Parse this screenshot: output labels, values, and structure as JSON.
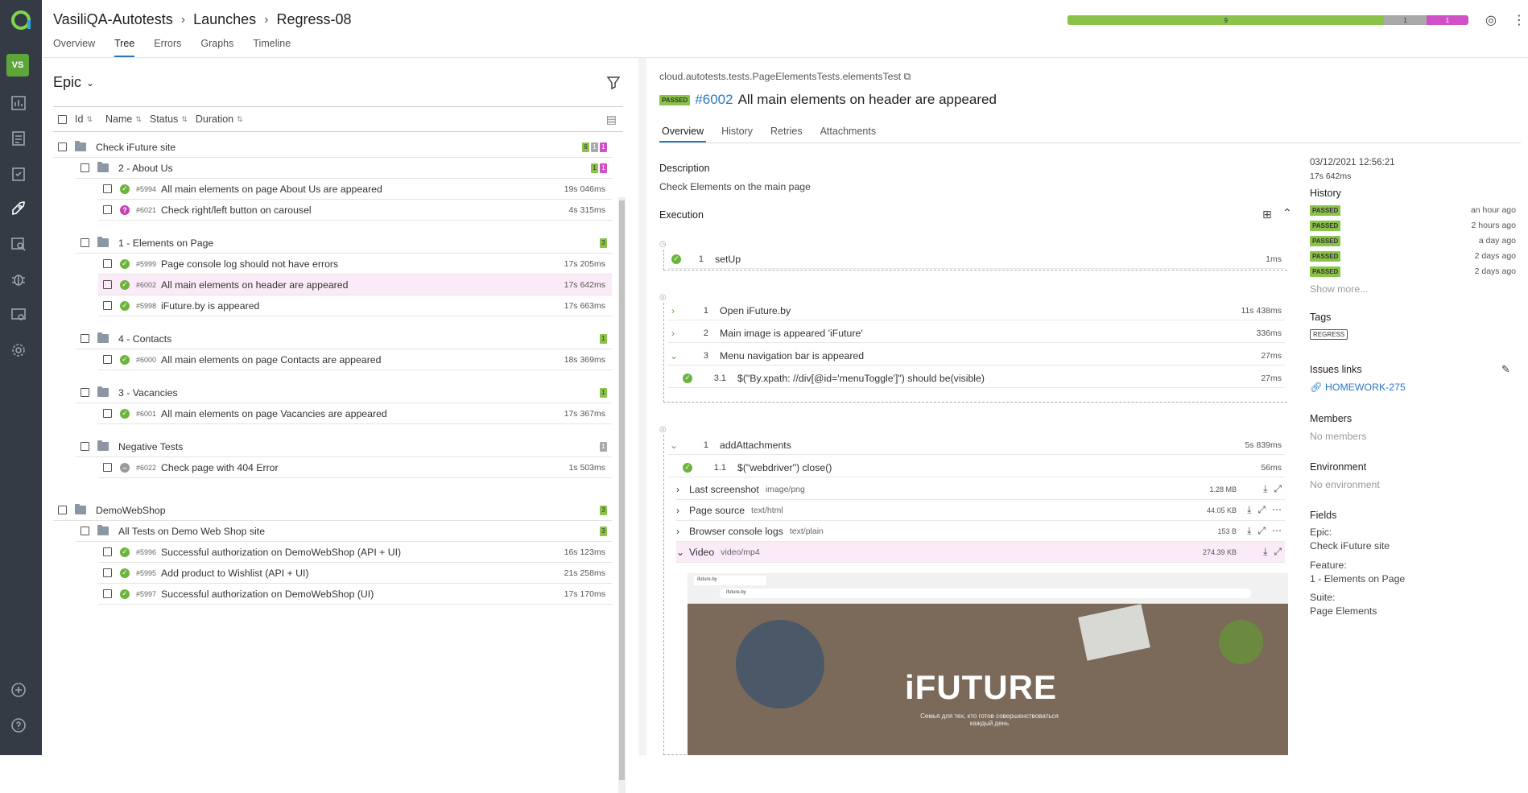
{
  "header": {
    "breadcrumbs": [
      "VasiliQA-Autotests",
      "Launches",
      "Regress-08"
    ],
    "tabs": [
      "Overview",
      "Tree",
      "Errors",
      "Graphs",
      "Timeline"
    ],
    "stats": {
      "passed": "9",
      "skipped": "1",
      "unknown": "1"
    }
  },
  "sidebar": {
    "avatar": "VS"
  },
  "left": {
    "group_title": "Epic",
    "columns": [
      "Id",
      "Name",
      "Status",
      "Duration"
    ],
    "tree": [
      {
        "type": "group",
        "name": "Check iFuture site",
        "counts": [
          "6",
          "1",
          "1"
        ]
      },
      {
        "type": "group",
        "name": "2 - About Us",
        "counts": [
          "1",
          "1"
        ]
      },
      {
        "type": "test",
        "id": "#5994",
        "name": "All main elements on page About Us are appeared",
        "duration": "19s 046ms",
        "status": "passed"
      },
      {
        "type": "test",
        "id": "#6021",
        "name": "Check right/left button on carousel",
        "duration": "4s 315ms",
        "status": "unknown"
      },
      {
        "type": "group",
        "name": "1 - Elements on Page",
        "counts": [
          "3"
        ]
      },
      {
        "type": "test",
        "id": "#5999",
        "name": "Page console log should not have errors",
        "duration": "17s 205ms",
        "status": "passed"
      },
      {
        "type": "test",
        "id": "#6002",
        "name": "All main elements on header are appeared",
        "duration": "17s 642ms",
        "status": "passed"
      },
      {
        "type": "test",
        "id": "#5998",
        "name": "iFuture.by is appeared",
        "duration": "17s 663ms",
        "status": "passed"
      },
      {
        "type": "group",
        "name": "4 - Contacts",
        "counts": [
          "1"
        ]
      },
      {
        "type": "test",
        "id": "#6000",
        "name": "All main elements on page Contacts are appeared",
        "duration": "18s 369ms",
        "status": "passed"
      },
      {
        "type": "group",
        "name": "3 - Vacancies",
        "counts": [
          "1"
        ]
      },
      {
        "type": "test",
        "id": "#6001",
        "name": "All main elements on page Vacancies are appeared",
        "duration": "17s 367ms",
        "status": "passed"
      },
      {
        "type": "group",
        "name": "Negative Tests",
        "counts": [
          "1"
        ]
      },
      {
        "type": "test",
        "id": "#6022",
        "name": "Check page with 404 Error",
        "duration": "1s 503ms",
        "status": "skipped"
      },
      {
        "type": "group",
        "name": "DemoWebShop",
        "counts": [
          "3"
        ]
      },
      {
        "type": "group",
        "name": "All Tests on Demo Web Shop site",
        "counts": [
          "3"
        ]
      },
      {
        "type": "test",
        "id": "#5996",
        "name": "Successful authorization on DemoWebShop (API + UI)",
        "duration": "16s 123ms",
        "status": "passed"
      },
      {
        "type": "test",
        "id": "#5995",
        "name": "Add product to Wishlist (API + UI)",
        "duration": "21s 258ms",
        "status": "passed"
      },
      {
        "type": "test",
        "id": "#5997",
        "name": "Successful authorization on DemoWebShop (UI)",
        "duration": "17s 170ms",
        "status": "passed"
      }
    ]
  },
  "detail": {
    "path": "cloud.autotests.tests.PageElementsTests.elementsTest",
    "status": "PASSED",
    "number": "#6002",
    "title": "All main elements on header are appeared",
    "tabs": [
      "Overview",
      "History",
      "Retries",
      "Attachments"
    ],
    "description_label": "Description",
    "description": "Check Elements on the main page",
    "execution_label": "Execution",
    "setup": {
      "n": "1",
      "name": "setUp",
      "duration": "1ms"
    },
    "steps": [
      {
        "n": "1",
        "name": "Open iFuture.by",
        "duration": "11s 438ms"
      },
      {
        "n": "2",
        "name": "Main image is appeared 'iFuture'",
        "duration": "336ms"
      },
      {
        "n": "3",
        "name": "Menu navigation bar is appeared",
        "duration": "27ms"
      },
      {
        "n": "3.1",
        "name": "$(\"By.xpath: //div[@id='menuToggle']\") should be(visible)",
        "duration": "27ms"
      }
    ],
    "teardown": {
      "n": "1",
      "name": "addAttachments",
      "duration": "5s 839ms"
    },
    "teardown_step": {
      "n": "1.1",
      "name": "$(\"webdriver\") close()",
      "duration": "56ms"
    },
    "attachments": [
      {
        "name": "Last screenshot",
        "type": "image/png",
        "size": "1.28 MB"
      },
      {
        "name": "Page source",
        "type": "text/html",
        "size": "44.05 KB"
      },
      {
        "name": "Browser console logs",
        "type": "text/plain",
        "size": "153 B"
      },
      {
        "name": "Video",
        "type": "video/mp4",
        "size": "274.39 KB"
      }
    ],
    "video": {
      "tab": "ifuture.by",
      "url": "ifuture.by",
      "brand": "iFUTURE",
      "tagline": "Семья для тех, кто готов совершенствоваться каждый день"
    }
  },
  "side": {
    "date": "03/12/2021 12:56:21",
    "duration": "17s 642ms",
    "history_label": "History",
    "history": [
      {
        "status": "PASSED",
        "ago": "an hour ago"
      },
      {
        "status": "PASSED",
        "ago": "2 hours ago"
      },
      {
        "status": "PASSED",
        "ago": "a day ago"
      },
      {
        "status": "PASSED",
        "ago": "2 days ago"
      },
      {
        "status": "PASSED",
        "ago": "2 days ago"
      }
    ],
    "show_more": "Show more...",
    "tags_label": "Tags",
    "tag": "REGRESS",
    "issues_label": "Issues links",
    "issue": "HOMEWORK-275",
    "members_label": "Members",
    "members": "No members",
    "env_label": "Environment",
    "env": "No environment",
    "fields_label": "Fields",
    "fields": [
      {
        "k": "Epic:",
        "v": "Check iFuture site"
      },
      {
        "k": "Feature:",
        "v": "1 - Elements on Page"
      },
      {
        "k": "Suite:",
        "v": "Page Elements"
      }
    ]
  },
  "colors": {
    "passed": "#8bc34a",
    "skipped": "#a9a9a9",
    "unknown": "#d050c5",
    "accent": "#2a78c5",
    "sidebar": "#353b45"
  }
}
